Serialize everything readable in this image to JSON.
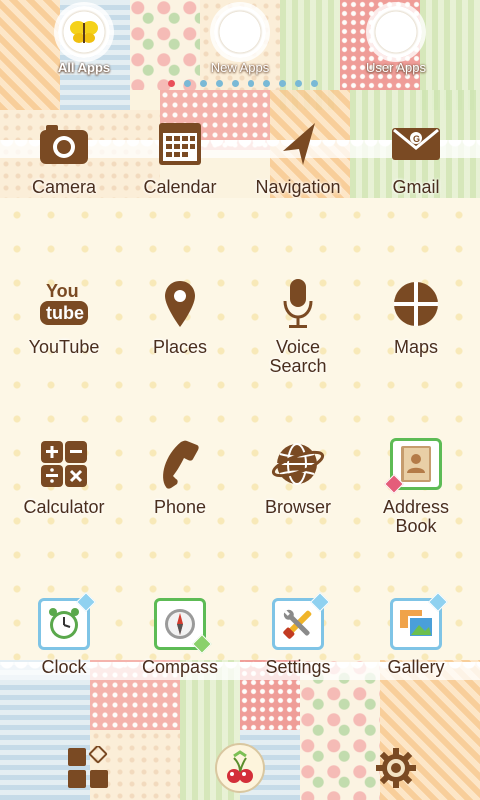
{
  "tabs": [
    {
      "label": "All Apps",
      "active": true
    },
    {
      "label": "New Apps",
      "active": false
    },
    {
      "label": "User Apps",
      "active": false
    }
  ],
  "page_indicator": {
    "count": 10,
    "active_index": 0
  },
  "dock_row_top": [
    {
      "label": "Camera",
      "icon": "camera-icon"
    },
    {
      "label": "Calendar",
      "icon": "calendar-icon"
    },
    {
      "label": "Navigation",
      "icon": "navigation-arrow-icon"
    },
    {
      "label": "Gmail",
      "icon": "gmail-envelope-icon"
    }
  ],
  "row1": [
    {
      "label": "YouTube",
      "icon": "youtube-icon",
      "icon_text_1": "You",
      "icon_text_2": "tube"
    },
    {
      "label": "Places",
      "icon": "map-pin-icon"
    },
    {
      "label": "Voice\nSearch",
      "icon": "microphone-icon"
    },
    {
      "label": "Maps",
      "icon": "map-icon"
    }
  ],
  "row2": [
    {
      "label": "Calculator",
      "icon": "calculator-icon"
    },
    {
      "label": "Phone",
      "icon": "phone-handset-icon"
    },
    {
      "label": "Browser",
      "icon": "globe-icon"
    },
    {
      "label": "Address\nBook",
      "icon": "address-book-icon"
    }
  ],
  "row3": [
    {
      "label": "Clock",
      "icon": "alarm-clock-icon"
    },
    {
      "label": "Compass",
      "icon": "compass-icon"
    },
    {
      "label": "Settings",
      "icon": "tools-icon"
    },
    {
      "label": "Gallery",
      "icon": "photos-icon"
    }
  ],
  "dock": [
    {
      "icon": "app-drawer-grid-icon"
    },
    {
      "icon": "cherry-home-icon"
    },
    {
      "icon": "gear-icon"
    }
  ],
  "colors": {
    "brown": "#7a4a23",
    "label": "#4a2e1e",
    "accent_blue": "#7fc4e6",
    "accent_green": "#5dbb55"
  }
}
